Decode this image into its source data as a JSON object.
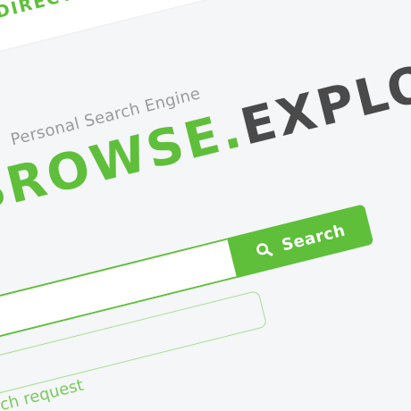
{
  "header": {
    "directory_link": "DIRECTORY"
  },
  "hero": {
    "tagline": "Personal Search Engine",
    "logo_part_green": "BROWSE",
    "logo_dot": ".",
    "logo_part_dark": "EXPLORE"
  },
  "search": {
    "input_value": "",
    "button_label": "Search",
    "button_icon": "search-icon",
    "hint_text": "Search request"
  },
  "colors": {
    "accent": "#5fbf3a",
    "dark_text": "#4a4a4a",
    "muted_text": "#9a9a9a",
    "background": "#f4f6f8"
  }
}
